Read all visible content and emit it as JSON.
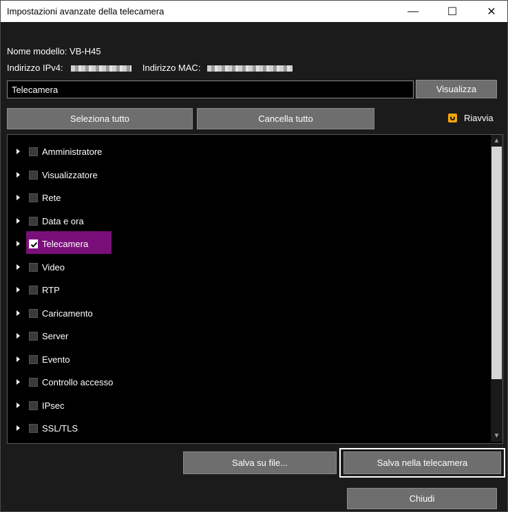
{
  "window": {
    "title": "Impostazioni avanzate della telecamera",
    "controls": {
      "minimize": "—",
      "maximize": "☐",
      "close": "✕"
    }
  },
  "info": {
    "model": "Nome modello: VB-H45",
    "ipv4_label": "Indirizzo IPv4:",
    "mac_label": "Indirizzo MAC:"
  },
  "camera": {
    "name_value": "Telecamera",
    "view_button": "Visualizza"
  },
  "selection": {
    "select_all": "Seleziona tutto",
    "clear_all": "Cancella tutto",
    "restart_label": "Riavvia"
  },
  "tree": {
    "items": [
      {
        "label": "Amministratore",
        "checked": false
      },
      {
        "label": "Visualizzatore",
        "checked": false
      },
      {
        "label": "Rete",
        "checked": false
      },
      {
        "label": "Data e ora",
        "checked": false
      },
      {
        "label": "Telecamera",
        "checked": true
      },
      {
        "label": "Video",
        "checked": false
      },
      {
        "label": "RTP",
        "checked": false
      },
      {
        "label": "Caricamento",
        "checked": false
      },
      {
        "label": "Server",
        "checked": false
      },
      {
        "label": "Evento",
        "checked": false
      },
      {
        "label": "Controllo accesso",
        "checked": false
      },
      {
        "label": "IPsec",
        "checked": false
      },
      {
        "label": "SSL/TLS",
        "checked": false
      }
    ],
    "highlight_color": "#7a0f7a"
  },
  "footer": {
    "save_file": "Salva su file...",
    "save_camera": "Salva nella telecamera",
    "close": "Chiudi"
  },
  "colors": {
    "accent_orange": "#f2a50c",
    "background": "#1b1b1b",
    "button": "#6e6e6e"
  }
}
